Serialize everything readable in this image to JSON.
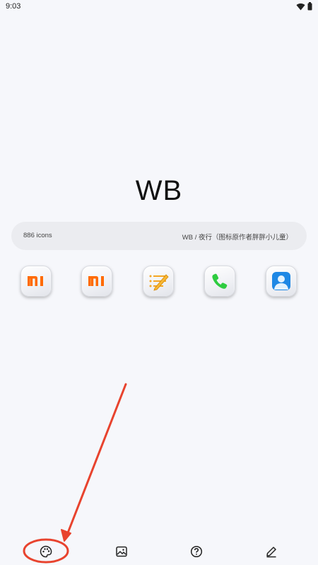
{
  "status_bar": {
    "time": "9:03",
    "icons": [
      "wifi-icon",
      "battery-icon"
    ]
  },
  "pack": {
    "title": "WB",
    "icon_count": "886 icons",
    "author": "WB / 夜行（图标原作者胖胖小儿童）"
  },
  "preview_icons": [
    {
      "name": "mi-icon",
      "color": "#ff6a00"
    },
    {
      "name": "mi-icon",
      "color": "#ff6a00"
    },
    {
      "name": "notes-icon",
      "color": "#f5a623"
    },
    {
      "name": "phone-icon",
      "color": "#2ecc40"
    },
    {
      "name": "contacts-icon",
      "color": "#1e88e5"
    }
  ],
  "bottom_nav": [
    {
      "name": "palette-icon",
      "selected": true
    },
    {
      "name": "image-icon",
      "selected": false
    },
    {
      "name": "help-icon",
      "selected": false
    },
    {
      "name": "edit-icon",
      "selected": false
    }
  ],
  "annotation": {
    "color": "#e8432e"
  }
}
